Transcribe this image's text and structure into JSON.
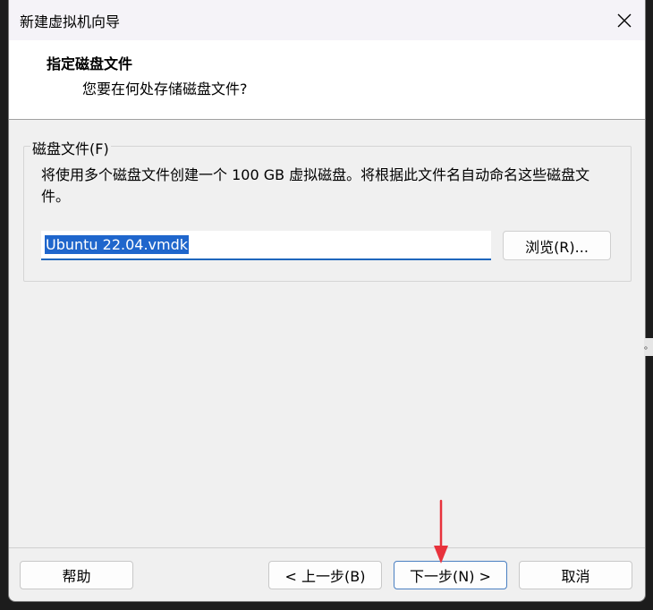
{
  "window": {
    "title": "新建虚拟机向导"
  },
  "header": {
    "title": "指定磁盘文件",
    "subtitle": "您要在何处存储磁盘文件?"
  },
  "disk_file_group": {
    "label": "磁盘文件(F)",
    "description": "将使用多个磁盘文件创建一个 100 GB 虚拟磁盘。将根据此文件名自动命名这些磁盘文件。",
    "file_value": "Ubuntu 22.04.vmdk",
    "browse_label": "浏览(R)..."
  },
  "footer": {
    "help_label": "帮助",
    "back_label": "< 上一步(B)",
    "next_label": "下一步(N) >",
    "cancel_label": "取消"
  },
  "side_tab": {
    "text": "。"
  },
  "colors": {
    "accent": "#1f66cc",
    "annotation_arrow": "#e8323c"
  },
  "icons": {
    "close": "close-icon",
    "arrow": "annotation-arrow-icon"
  }
}
